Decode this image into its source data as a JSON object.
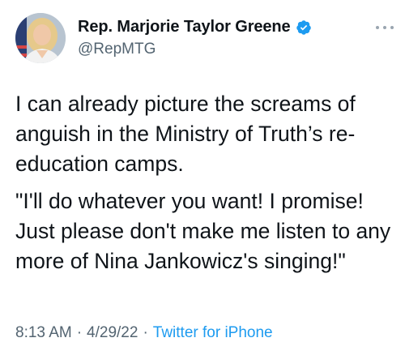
{
  "author": {
    "display_name": "Rep. Marjorie Taylor Greene",
    "handle": "@RepMTG",
    "verified": true
  },
  "tweet": {
    "paragraphs": [
      "I can already picture the screams of anguish in the Ministry of Truth’s re-education camps.",
      "\"I'll do whatever you want! I promise! Just please don't make me listen to any more of Nina Jankowicz's singing!\""
    ]
  },
  "meta": {
    "time": "8:13 AM",
    "separator": "·",
    "date": "4/29/22",
    "source": "Twitter for iPhone"
  },
  "colors": {
    "verified_blue": "#1d9bf0",
    "secondary_text": "#536471",
    "primary_text": "#0f1419"
  },
  "icons": {
    "verified": "verified-badge-icon",
    "more": "more-dots-icon"
  }
}
